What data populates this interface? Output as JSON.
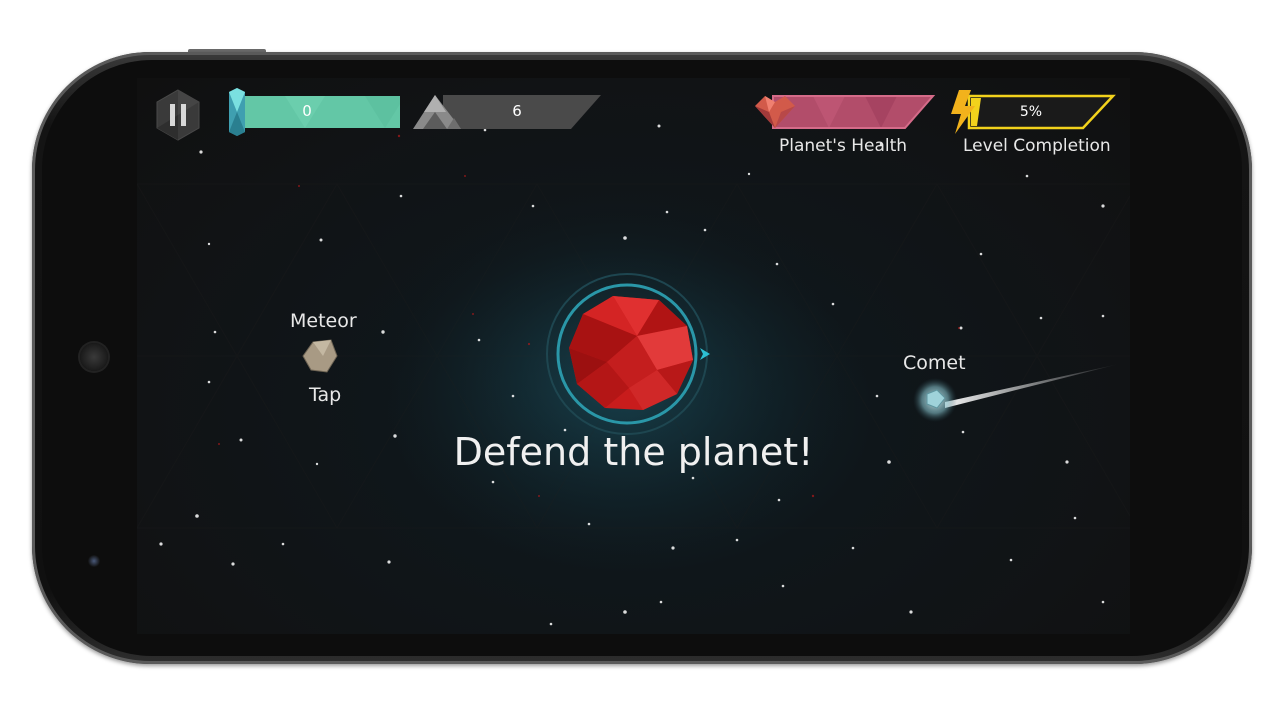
{
  "hud": {
    "crystals": "0",
    "shards": "6",
    "health_label": "Planet's Health",
    "completion_value": "5%",
    "completion_label": "Level Completion"
  },
  "tutorial": {
    "meteor_label": "Meteor",
    "meteor_action": "Tap",
    "comet_label": "Comet",
    "headline": "Defend the planet!"
  },
  "colors": {
    "crystal_bar": "#63c7a6",
    "health_bar": "#b24d6a",
    "completion_border": "#f2d21c",
    "planet": "#c81c1c"
  }
}
